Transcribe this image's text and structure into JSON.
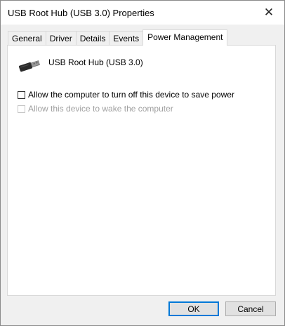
{
  "window": {
    "title": "USB Root Hub (USB 3.0) Properties",
    "close_glyph": "✕"
  },
  "tabs": [
    {
      "label": "General",
      "active": false
    },
    {
      "label": "Driver",
      "active": false
    },
    {
      "label": "Details",
      "active": false
    },
    {
      "label": "Events",
      "active": false
    },
    {
      "label": "Power Management",
      "active": true
    }
  ],
  "device": {
    "name": "USB Root Hub (USB 3.0)",
    "icon": "usb-plug-icon"
  },
  "options": [
    {
      "label": "Allow the computer to turn off this device to save power",
      "checked": false,
      "enabled": true
    },
    {
      "label": "Allow this device to wake the computer",
      "checked": false,
      "enabled": false
    }
  ],
  "buttons": {
    "ok": "OK",
    "cancel": "Cancel"
  }
}
